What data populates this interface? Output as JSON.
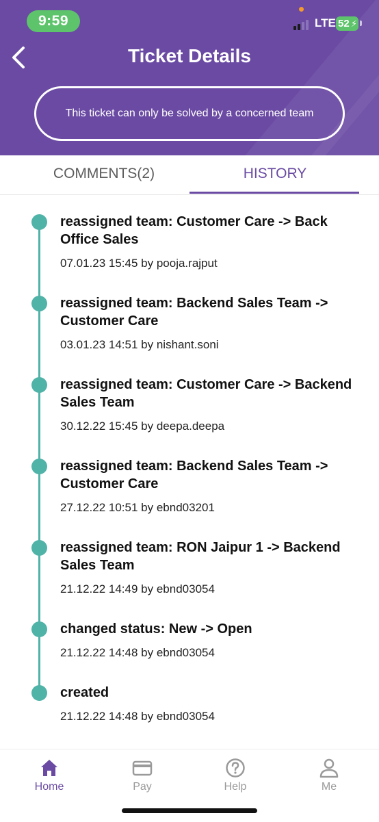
{
  "status_bar": {
    "time": "9:59",
    "network": "LTE",
    "battery": "52"
  },
  "header": {
    "title": "Ticket Details",
    "notice": "This ticket can only be solved by a concerned team",
    "back_icon": "chevron-left-icon"
  },
  "tabs": [
    {
      "label": "COMMENTS(2)",
      "active": false
    },
    {
      "label": "HISTORY",
      "active": true
    }
  ],
  "history": [
    {
      "title": "reassigned team: Customer Care -> Back Office Sales",
      "meta": "07.01.23 15:45 by pooja.rajput"
    },
    {
      "title": "reassigned team: Backend Sales Team -> Customer Care",
      "meta": "03.01.23 14:51 by nishant.soni"
    },
    {
      "title": "reassigned team: Customer Care -> Backend Sales Team",
      "meta": "30.12.22 15:45 by deepa.deepa"
    },
    {
      "title": "reassigned team: Backend Sales Team -> Customer Care",
      "meta": "27.12.22 10:51 by ebnd03201"
    },
    {
      "title": "reassigned team: RON Jaipur 1 -> Backend Sales Team",
      "meta": "21.12.22 14:49 by ebnd03054"
    },
    {
      "title": "changed status: New -> Open",
      "meta": "21.12.22 14:48 by ebnd03054"
    },
    {
      "title": "created",
      "meta": "21.12.22 14:48 by ebnd03054"
    }
  ],
  "bottom_nav": [
    {
      "label": "Home",
      "icon": "home-icon",
      "active": true
    },
    {
      "label": "Pay",
      "icon": "card-icon",
      "active": false
    },
    {
      "label": "Help",
      "icon": "help-icon",
      "active": false
    },
    {
      "label": "Me",
      "icon": "user-icon",
      "active": false
    }
  ],
  "colors": {
    "brand": "#6a4aa3",
    "timeline": "#4fb3a8",
    "status_pill": "#5ec46b"
  }
}
